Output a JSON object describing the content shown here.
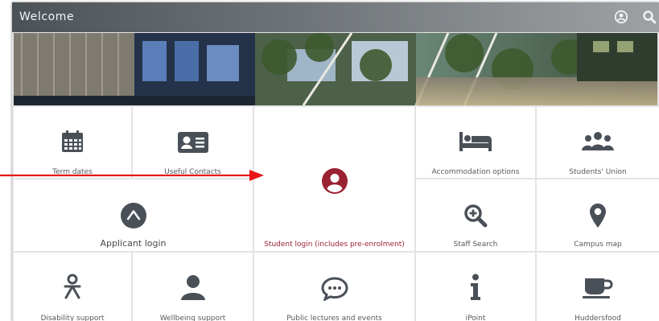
{
  "header": {
    "title": "Welcome",
    "icons": [
      "account-icon",
      "search-icon"
    ]
  },
  "tiles": {
    "term_dates": {
      "label": "Term dates",
      "icon": "calendar-icon"
    },
    "useful_contacts": {
      "label": "Useful Contacts",
      "icon": "contact-card-icon"
    },
    "student_login": {
      "label": "Student login (includes pre-enrolment)",
      "icon": "user-circle-icon"
    },
    "accommodation": {
      "label": "Accommodation options",
      "icon": "bed-icon"
    },
    "students_union": {
      "label": "Students' Union",
      "icon": "group-icon"
    },
    "applicant_login": {
      "label": "Applicant login",
      "icon": "applicant-a-icon"
    },
    "staff_search": {
      "label": "Staff Search",
      "icon": "search-plus-icon"
    },
    "campus_map": {
      "label": "Campus map",
      "icon": "map-marker-icon"
    },
    "disability": {
      "label": "Disability support",
      "icon": "accessibility-icon"
    },
    "wellbeing": {
      "label": "Wellbeing support",
      "icon": "person-icon"
    },
    "public_lectures": {
      "label": "Public lectures and events",
      "icon": "speech-bubble-icon"
    },
    "ipoint": {
      "label": "iPoint",
      "icon": "info-icon"
    },
    "huddersfood": {
      "label": "Huddersfood",
      "icon": "coffee-cup-icon"
    }
  },
  "colors": {
    "header_start": "#4c5358",
    "header_end": "#9ea2a5",
    "icon_gray": "#4a5058",
    "accent": "#9a2233",
    "arrow": "#e8161b",
    "grid_gap": "#e4e4e6"
  }
}
